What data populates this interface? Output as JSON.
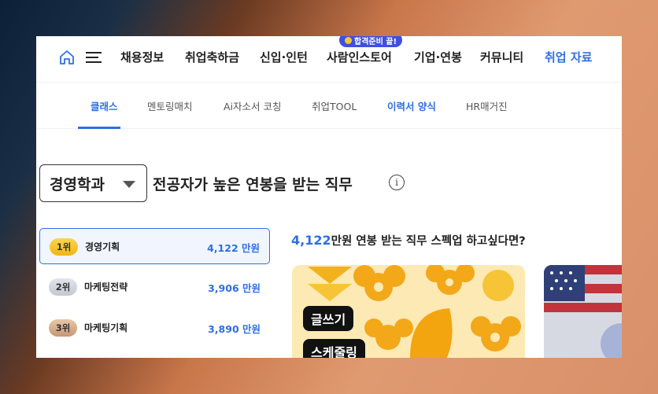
{
  "nav": {
    "items": [
      "채용정보",
      "취업축하금",
      "신입·인턴",
      "사람인스토어",
      "기업·연봉",
      "커뮤니티",
      "취업 자료"
    ],
    "badge": "합격준비 끝!"
  },
  "subnav": {
    "items": [
      "클래스",
      "멘토링매치",
      "Ai자소서 코칭",
      "취업TOOL",
      "이력서 양식",
      "HR매거진"
    ]
  },
  "major": {
    "value": "경영학과"
  },
  "heading": "전공자가 높은 연봉을 받는 직무",
  "ranking": [
    {
      "rank": "1위",
      "name": "경영기획",
      "salary": "4,122 만원"
    },
    {
      "rank": "2위",
      "name": "마케팅전략",
      "salary": "3,906 만원"
    },
    {
      "rank": "3위",
      "name": "마케팅기획",
      "salary": "3,890 만원"
    }
  ],
  "promo": {
    "num": "4,122",
    "text": "만원 연봉 받는 직무 스펙업 하고싶다면?"
  },
  "card": {
    "tags": [
      "글쓰기",
      "스케줄링"
    ]
  },
  "colors": {
    "accent": "#2f6fe4",
    "badge": "#3f4fe0"
  }
}
